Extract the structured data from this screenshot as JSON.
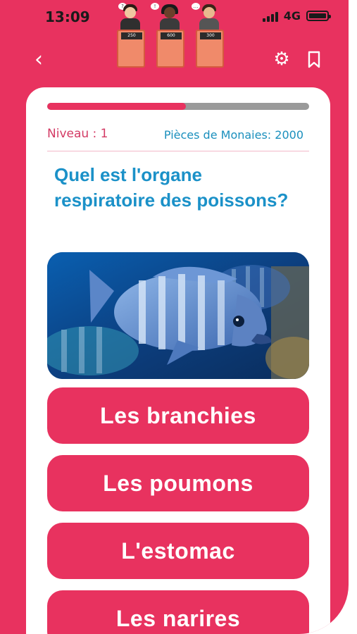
{
  "status": {
    "time": "13:09",
    "network": "4G"
  },
  "header": {
    "back_icon": "chevron-left-icon",
    "settings_icon": "gear-icon",
    "bookmark_icon": "bookmark-icon",
    "contestants": [
      {
        "score": "250"
      },
      {
        "score": "600"
      },
      {
        "score": "300"
      }
    ]
  },
  "quiz": {
    "progress": 0.53,
    "level_label": "Niveau : 1",
    "coins_label": "Pièces de Monaies: 2000",
    "question": "Quel est l'organe respiratoire des poissons?",
    "answers": [
      {
        "label": "Les branchies"
      },
      {
        "label": "Les poumons"
      },
      {
        "label": "L'estomac"
      },
      {
        "label": "Les narires"
      }
    ]
  },
  "colors": {
    "primary": "#e8325f",
    "question_text": "#1b91c8",
    "progress_track": "#9a9a9a"
  }
}
